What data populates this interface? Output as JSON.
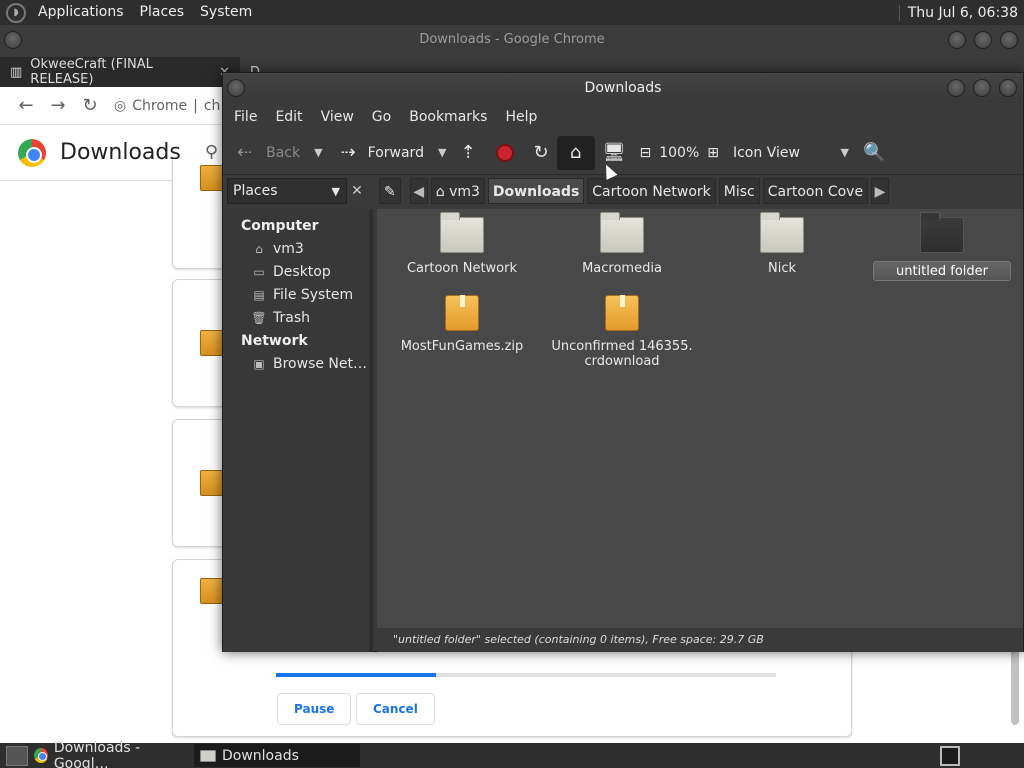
{
  "top_panel": {
    "menus": [
      "Applications",
      "Places",
      "System"
    ],
    "clock": "Thu Jul  6, 06:38"
  },
  "chrome": {
    "window_title": "Downloads - Google Chrome",
    "tabs": [
      {
        "label": "OkweeCraft (FINAL RELEASE)",
        "close": "✕"
      },
      {
        "label": "Downloads",
        "close": "✕"
      }
    ],
    "new_tab": "+",
    "omnibox_label": "Chrome",
    "omnibox_text": "ch",
    "page_title": "Downloads",
    "download_progress_fraction": 0.32,
    "pause_label": "Pause",
    "cancel_label": "Cancel"
  },
  "file_manager": {
    "window_title": "Downloads",
    "menu": [
      "File",
      "Edit",
      "View",
      "Go",
      "Bookmarks",
      "Help"
    ],
    "toolbar": {
      "back": "Back",
      "forward": "Forward",
      "zoom": "100%",
      "view_mode": "Icon View"
    },
    "places_label": "Places",
    "places_close": "✕",
    "breadcrumbs": [
      "vm3",
      "Downloads",
      "Cartoon Network",
      "Misc",
      "Cartoon Cove"
    ],
    "sidebar": {
      "computer_header": "Computer",
      "computer_items": [
        {
          "label": "vm3",
          "icon": "home-icon"
        },
        {
          "label": "Desktop",
          "icon": "desktop-icon"
        },
        {
          "label": "File System",
          "icon": "drive-icon"
        },
        {
          "label": "Trash",
          "icon": "trash-icon"
        }
      ],
      "network_header": "Network",
      "network_items": [
        {
          "label": "Browse Net…",
          "icon": "network-icon"
        }
      ]
    },
    "items": [
      {
        "name": "Cartoon Network",
        "type": "folder"
      },
      {
        "name": "Macromedia",
        "type": "folder"
      },
      {
        "name": "Nick",
        "type": "folder"
      },
      {
        "name": "untitled folder",
        "type": "folder",
        "selected": true
      },
      {
        "name": "MostFunGames.zip",
        "type": "archive"
      },
      {
        "name": "Unconfirmed 146355.crdownload",
        "name_line1": "Unconfirmed 146355.",
        "name_line2": "crdownload",
        "type": "archive"
      }
    ],
    "status": "\"untitled folder\" selected (containing 0 items), Free space: 29.7 GB"
  },
  "taskbar": {
    "tasks": [
      {
        "label": "Downloads - Googl…",
        "icon": "chrome-icon"
      },
      {
        "label": "Downloads",
        "icon": "folder-icon",
        "active": true
      }
    ]
  },
  "colors": {
    "panel_bg": "#2e2e2e",
    "fm_bg": "#3a3a3a",
    "icon_view_bg": "#484848",
    "chrome_accent": "#1a73e8",
    "stop_red": "#c8262c"
  }
}
